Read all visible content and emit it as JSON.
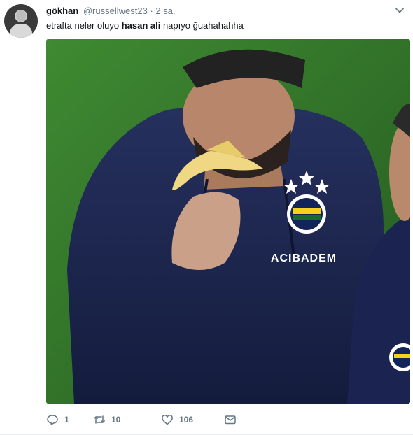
{
  "tweet": {
    "display_name": "gökhan",
    "handle": "@russellwest23",
    "separator": "·",
    "time": "2 sa.",
    "text_before": "etrafta neler oluyo ",
    "text_bold": "hasan ali",
    "text_after": " napıyo ğuahahahha",
    "image": {
      "sponsor_text": "ACIBADEM"
    },
    "actions": {
      "reply_count": "1",
      "retweet_count": "10",
      "like_count": "106"
    }
  },
  "icons": [
    "avatar",
    "chevron-down-icon",
    "reply-icon",
    "retweet-icon",
    "heart-icon",
    "message-icon"
  ],
  "colors": {
    "text": "#14171a",
    "secondary": "#657786",
    "jersey": "#1f2a55",
    "pitch": "#2f6e28"
  }
}
